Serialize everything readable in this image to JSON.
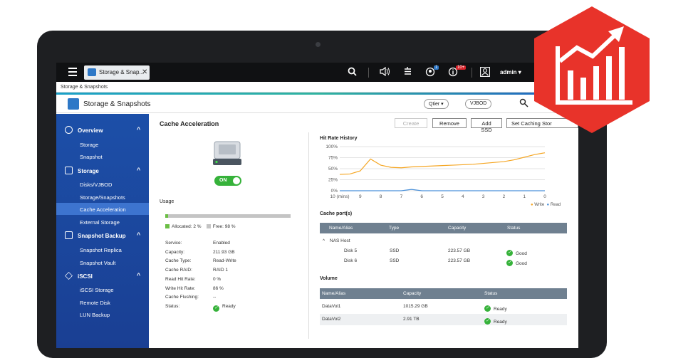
{
  "topbar": {
    "tab_title": "Storage & Snap...",
    "notification_badge": "1",
    "info_badge": "10+",
    "user": "admin"
  },
  "breadcrumb": "Storage & Snapshots",
  "app": {
    "title": "Storage & Snapshots",
    "qtier": "Qtier",
    "vjbod": "VJBOD"
  },
  "sidebar": {
    "groups": [
      {
        "label": "Overview",
        "items": [
          "Storage",
          "Snapshot"
        ]
      },
      {
        "label": "Storage",
        "items": [
          "Disks/VJBOD",
          "Storage/Snapshots",
          "Cache Acceleration",
          "External Storage"
        ]
      },
      {
        "label": "Snapshot Backup",
        "items": [
          "Snapshot Replica",
          "Snapshot Vault"
        ]
      },
      {
        "label": "iSCSI",
        "items": [
          "iSCSI Storage",
          "Remote Disk",
          "LUN Backup"
        ]
      }
    ],
    "active_item": "Cache Acceleration"
  },
  "main": {
    "title": "Cache Acceleration",
    "buttons": [
      "Create",
      "Remove",
      "Add SSD",
      "Set Caching Stor"
    ],
    "toggle": "ON",
    "usage": {
      "label": "Usage",
      "allocated_fraction": 0.02,
      "allocated_label": "Allocated: 2 %",
      "free_label": "Free: 98 %"
    },
    "properties": [
      {
        "name": "Service:",
        "value": "Enabled"
      },
      {
        "name": "Capacity:",
        "value": "211.93 GB"
      },
      {
        "name": "Cache Type:",
        "value": "Read-Write"
      },
      {
        "name": "Cache RAID:",
        "value": "RAID 1"
      },
      {
        "name": "Read Hit Rate:",
        "value": "0 %"
      },
      {
        "name": "Write Hit Rate:",
        "value": "86 %"
      },
      {
        "name": "Cache Flushing:",
        "value": "--"
      },
      {
        "name": "Status:",
        "value": "Ready"
      }
    ]
  },
  "hit_rate": {
    "title": "Hit Rate History",
    "legend": [
      "Write",
      "Read"
    ],
    "colors": {
      "write": "#f5a623",
      "read": "#4a90d9"
    }
  },
  "chart_data": {
    "type": "line",
    "x": [
      10,
      9.5,
      9,
      8.5,
      8,
      7.5,
      7,
      6.5,
      6,
      5.5,
      5,
      4.5,
      4,
      3.5,
      3,
      2.5,
      2,
      1.5,
      1,
      0.5,
      0
    ],
    "x_tick_labels": [
      "10 (mins)",
      "9",
      "8",
      "7",
      "6",
      "5",
      "4",
      "3",
      "2",
      "1",
      "0"
    ],
    "y_tick_labels": [
      "100%",
      "75%",
      "50%",
      "25%",
      "0%"
    ],
    "ylim": [
      0,
      100
    ],
    "series": [
      {
        "name": "Write",
        "values": [
          37,
          38,
          45,
          72,
          58,
          53,
          52,
          54,
          55,
          56,
          57,
          58,
          59,
          60,
          62,
          64,
          66,
          70,
          76,
          82,
          86
        ]
      },
      {
        "name": "Read",
        "values": [
          0,
          0,
          0,
          0,
          0,
          0,
          0,
          3,
          0,
          0,
          0,
          0,
          0,
          0,
          0,
          0,
          0,
          0,
          0,
          0,
          0
        ]
      }
    ]
  },
  "cache_ports": {
    "title": "Cache port(s)",
    "headers": [
      "Name/Alias",
      "Type",
      "Capacity",
      "Status"
    ],
    "group": "NAS Host",
    "rows": [
      {
        "name": "Disk 5",
        "type": "SSD",
        "capacity": "223.57 GB",
        "status": "Good"
      },
      {
        "name": "Disk 6",
        "type": "SSD",
        "capacity": "223.57 GB",
        "status": "Good"
      }
    ]
  },
  "volume": {
    "title": "Volume",
    "headers": [
      "Name/Alias",
      "Capacity",
      "Status"
    ],
    "rows": [
      {
        "name": "DataVol1",
        "capacity": "1015.29 GB",
        "status": "Ready"
      },
      {
        "name": "DataVol2",
        "capacity": "2.91 TB",
        "status": "Ready"
      }
    ]
  }
}
